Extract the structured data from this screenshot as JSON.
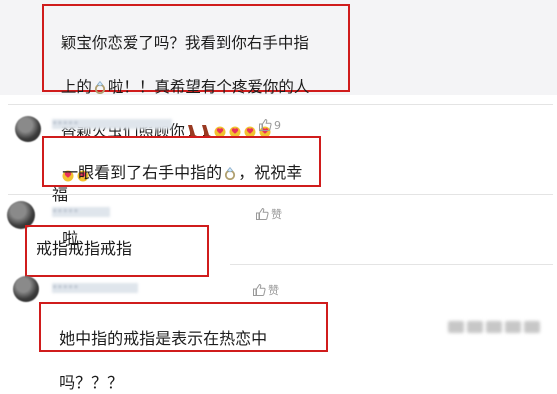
{
  "comments": [
    {
      "id": "c1",
      "lines": [
        "颖宝你恋爱了吗？我看到你右手中指",
        "上的",
        "啦！！真希望有个疼爱你的人",
        "替颖火虫们照顾你"
      ],
      "like_count": ""
    },
    {
      "id": "c2",
      "username": "•••••",
      "line1_pre": "一眼看到了右手中指的",
      "line1_post": "，祝祝幸福",
      "line2": "啦",
      "like_count": "9"
    },
    {
      "id": "c3",
      "username": "•••••",
      "text": "戒指戒指戒指",
      "like_label": "赞"
    },
    {
      "id": "c4",
      "username": "•••••",
      "line1": "她中指的戒指是表示在热恋中",
      "line2": "吗？？？",
      "like_label": "赞"
    }
  ],
  "colors": {
    "highlight_box": "#d01c1c",
    "like_icon": "#9a9a9a",
    "username": "#a8b2c0"
  },
  "icons": [
    "ring-emoji-icon",
    "heart-emoji-icon",
    "high-heel-emoji-icon",
    "thumbs-up-icon",
    "avatar"
  ]
}
